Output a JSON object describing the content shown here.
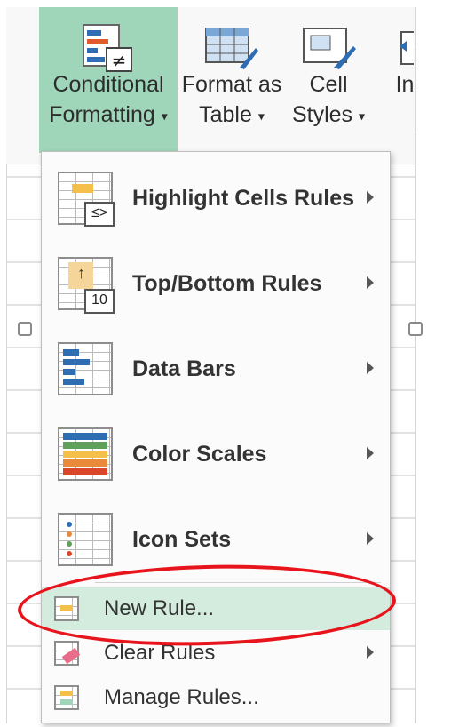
{
  "ribbon": {
    "conditional_formatting": {
      "line1": "Conditional",
      "line2": "Formatting"
    },
    "format_as_table": {
      "line1": "Format as",
      "line2": "Table"
    },
    "cell_styles": {
      "line1": "Cell",
      "line2": "Styles"
    },
    "insert_partial": "In"
  },
  "menu": {
    "items_big": [
      {
        "label": "Highlight Cells Rules",
        "icon": "highlight-cells-icon"
      },
      {
        "label": "Top/Bottom Rules",
        "icon": "top-bottom-icon",
        "badge": "10"
      },
      {
        "label": "Data Bars",
        "icon": "data-bars-icon"
      },
      {
        "label": "Color Scales",
        "icon": "color-scales-icon"
      },
      {
        "label": "Icon Sets",
        "icon": "icon-sets-icon"
      }
    ],
    "items_small": [
      {
        "label": "New Rule...",
        "icon": "new-rule-icon"
      },
      {
        "label": "Clear Rules",
        "icon": "clear-rules-icon"
      },
      {
        "label": "Manage Rules...",
        "icon": "manage-rules-icon"
      }
    ]
  },
  "colors": {
    "active": "#9fd5b8",
    "highlight": "#d3ecde",
    "annotation": "#e8141c"
  }
}
